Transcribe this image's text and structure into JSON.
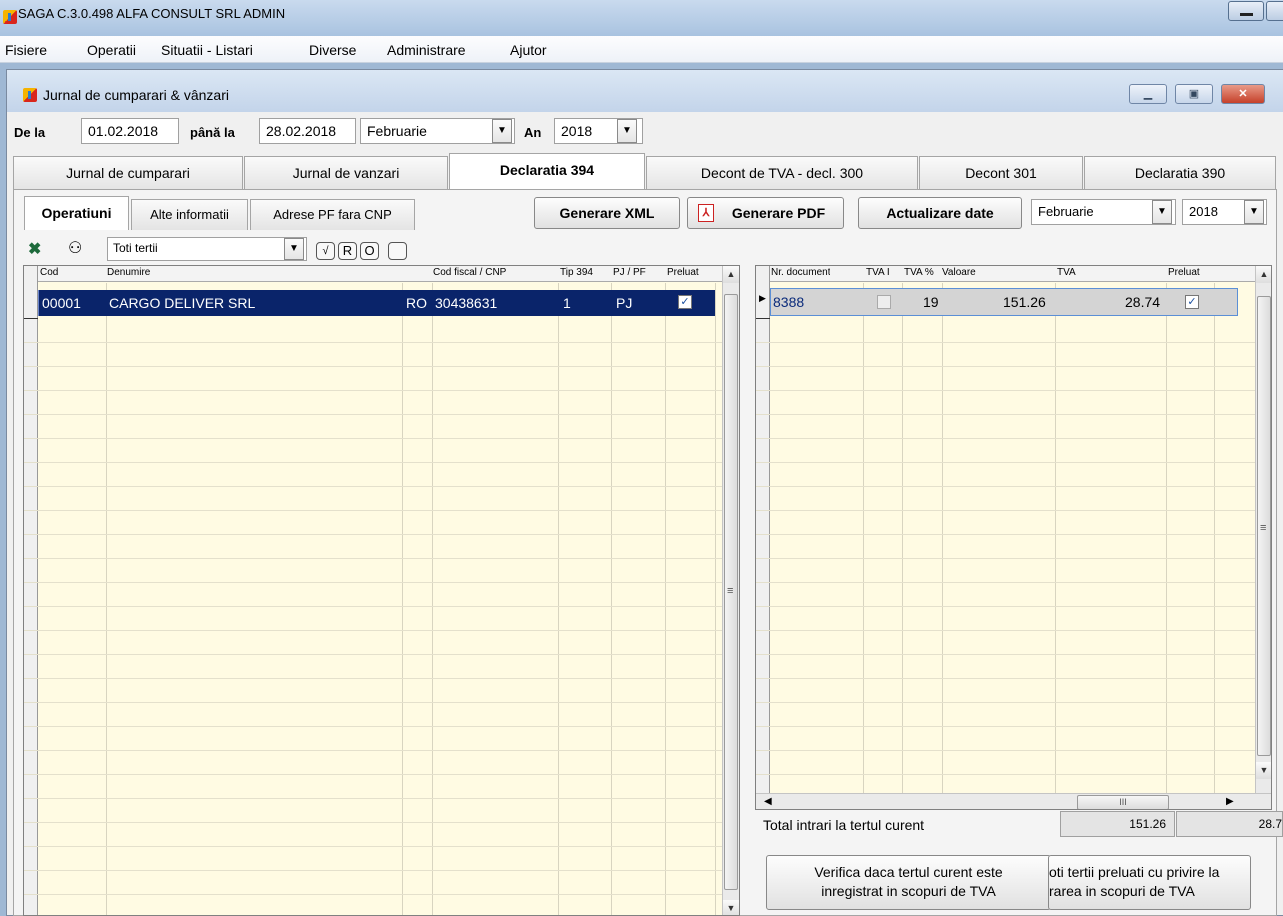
{
  "app": {
    "title": "SAGA C.3.0.498  ALFA CONSULT SRL  ADMIN"
  },
  "menu": [
    "Fisiere",
    "Operatii",
    "Situatii - Listari",
    "Diverse",
    "Administrare",
    "Ajutor"
  ],
  "window": {
    "title": "Jurnal de cumparari & vânzari"
  },
  "filter": {
    "from_label": "De la",
    "from_value": "01.02.2018",
    "to_label": "până la",
    "to_value": "28.02.2018",
    "month_value": "Februarie",
    "year_label": "An",
    "year_value": "2018"
  },
  "main_tabs": [
    "Jurnal de cumparari",
    "Jurnal de vanzari",
    "Declaratia 394",
    "Decont de TVA - decl. 300",
    "Decont 301",
    "Declaratia 390"
  ],
  "sub_tabs": [
    "Operatiuni",
    "Alte informatii",
    "Adrese PF fara CNP"
  ],
  "actions": {
    "xml": "Generare XML",
    "pdf": "Generare PDF",
    "update": "Actualizare date",
    "month": "Februarie",
    "year": "2018"
  },
  "tertii_filter": {
    "value": "Toti tertii",
    "btn_check": "√",
    "btn_r": "R",
    "btn_o": "O"
  },
  "left_grid": {
    "headers": [
      "Cod",
      "Denumire",
      "Cod fiscal / CNP",
      "Tip 394",
      "PJ / PF",
      "Preluat"
    ],
    "rows": [
      {
        "cod": "00001",
        "denumire": "CARGO DELIVER SRL",
        "prefix": "RO",
        "cif": "30438631",
        "tip": "1",
        "pjpf": "PJ",
        "preluat": "✓"
      }
    ]
  },
  "right_grid": {
    "headers": [
      "Nr. document",
      "TVA I",
      "TVA %",
      "Valoare",
      "TVA",
      "Preluat"
    ],
    "rows": [
      {
        "nr": "8388",
        "tva_i": "",
        "tva_pct": "19",
        "valoare": "151.26",
        "tva": "28.74",
        "preluat": "✓"
      }
    ]
  },
  "totals": {
    "label": "Total intrari la tertul curent",
    "valoare": "151.26",
    "tva": "28.7"
  },
  "bottom_buttons": {
    "verify_line1": "Verifica daca tertul curent este",
    "verify_line2": "inregistrat in scopuri de TVA",
    "all_line1": "oti tertii preluati cu privire la",
    "all_line2": "rarea in scopuri de TVA"
  },
  "scroll_glyphs": {
    "grip": "≡",
    "grip_h": "III"
  }
}
